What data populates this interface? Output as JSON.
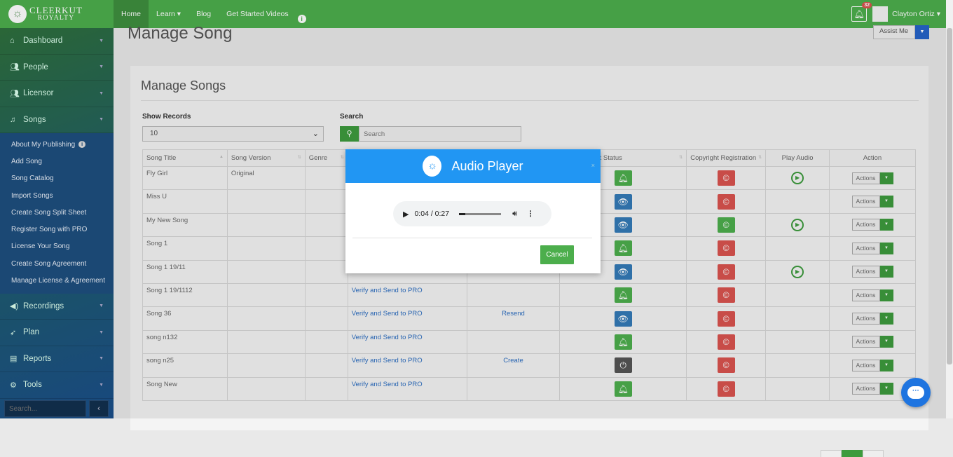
{
  "brand": {
    "line1": "CLEERKUT",
    "line2": "ROYALTY"
  },
  "nav": {
    "home": "Home",
    "learn": "Learn",
    "blog": "Blog",
    "videos": "Get Started Videos"
  },
  "topright": {
    "notif_count": "32",
    "user": "Clayton Ortiz"
  },
  "sidebar": {
    "items_top": [
      {
        "label": "Dashboard",
        "icon": "home-icon"
      },
      {
        "label": "People",
        "icon": "users-icon"
      },
      {
        "label": "Licensor",
        "icon": "users-icon"
      },
      {
        "label": "Songs",
        "icon": "music-icon"
      }
    ],
    "songs_sub": [
      "About My Publishing",
      "Add Song",
      "Song Catalog",
      "Import Songs",
      "Create Song Split Sheet",
      "Register Song with PRO",
      "License Your Song",
      "Create Song Agreement",
      "Manage License & Agreement"
    ],
    "items_bottom": [
      {
        "label": "Recordings",
        "icon": "volume-icon"
      },
      {
        "label": "Plan",
        "icon": "rocket-icon"
      },
      {
        "label": "Reports",
        "icon": "report-icon"
      },
      {
        "label": "Tools",
        "icon": "cogs-icon"
      }
    ],
    "search_placeholder": "Search..."
  },
  "page": {
    "title": "Manage Song",
    "assist": "Assist Me"
  },
  "panel": {
    "title": "Manage Songs",
    "show_records_label": "Show Records",
    "show_records_value": "10",
    "search_label": "Search",
    "search_placeholder": "Search"
  },
  "table": {
    "headers": [
      "Song Title",
      "Song Version",
      "Genre",
      "",
      "",
      "g Split Sheet Status",
      "Copyright Registration",
      "Play Audio",
      "Action"
    ],
    "action_label": "Actions",
    "rows": [
      {
        "title": "Fly Girl",
        "version": "Original",
        "pro": "",
        "agree": "",
        "split": "bell",
        "copy": "red",
        "play": true
      },
      {
        "title": "Miss U",
        "version": "",
        "pro": "",
        "agree": "",
        "split": "eye",
        "copy": "red",
        "play": false
      },
      {
        "title": "My New Song",
        "version": "",
        "pro": "",
        "agree": "",
        "split": "eye",
        "copy": "green",
        "play": true
      },
      {
        "title": "Song 1",
        "version": "",
        "pro": "",
        "agree": "",
        "split": "bell",
        "copy": "red",
        "play": false
      },
      {
        "title": "Song 1 19/11",
        "version": "",
        "pro": "",
        "agree": "",
        "split": "eye",
        "copy": "red",
        "play": true
      },
      {
        "title": "Song 1 19/1112",
        "version": "",
        "pro": "Verify and Send to PRO",
        "agree": "",
        "split": "bell",
        "copy": "red",
        "play": false
      },
      {
        "title": "Song 36",
        "version": "",
        "pro": "Verify and Send to PRO",
        "agree": "Resend",
        "split": "eye",
        "copy": "red",
        "play": false
      },
      {
        "title": "song n132",
        "version": "",
        "pro": "Verify and Send to PRO",
        "agree": "",
        "split": "bell",
        "copy": "red",
        "play": false
      },
      {
        "title": "song n25",
        "version": "",
        "pro": "Verify and Send to PRO",
        "agree": "Create",
        "split": "power",
        "copy": "red",
        "play": false
      },
      {
        "title": "Song New",
        "version": "",
        "pro": "Verify and Send to PRO",
        "agree": "",
        "split": "bell",
        "copy": "red",
        "play": false
      }
    ]
  },
  "modal": {
    "title": "Audio Player",
    "time": "0:04 / 0:27",
    "progress": 0.15,
    "cancel": "Cancel"
  }
}
